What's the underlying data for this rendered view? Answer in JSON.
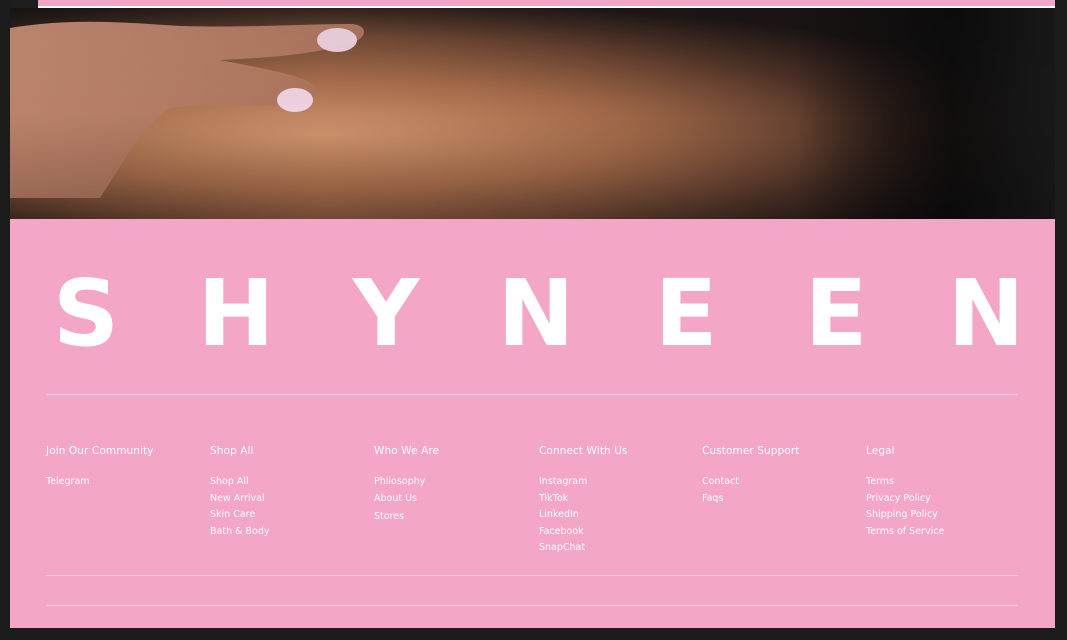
{
  "brand": {
    "letters": [
      "S",
      "H",
      "Y",
      "N",
      "E",
      "E",
      "N"
    ]
  },
  "colors": {
    "footer_bg": "#f4a6c6",
    "text": "#ffffff",
    "frame": "#1b1b1b"
  },
  "footer": {
    "columns": [
      {
        "title": "Join Our Community",
        "links": [
          "Telegram"
        ]
      },
      {
        "title": "Shop All",
        "links": [
          "Shop All",
          "New Arrival",
          "Skin Care",
          "Bath & Body"
        ]
      },
      {
        "title": "Who We Are",
        "links": [
          "Philosophy",
          "About Us",
          "Stores"
        ]
      },
      {
        "title": "Connect With Us",
        "links": [
          "Instagram",
          "TikTok",
          "LinkedIn",
          "Facebook",
          "SnapChat"
        ]
      },
      {
        "title": "Customer Support",
        "links": [
          "Contact",
          "Faqs"
        ]
      },
      {
        "title": "Legal",
        "links": [
          "Terms",
          "Privacy Policy",
          "Shipping Policy",
          "Terms of Service"
        ]
      }
    ]
  }
}
